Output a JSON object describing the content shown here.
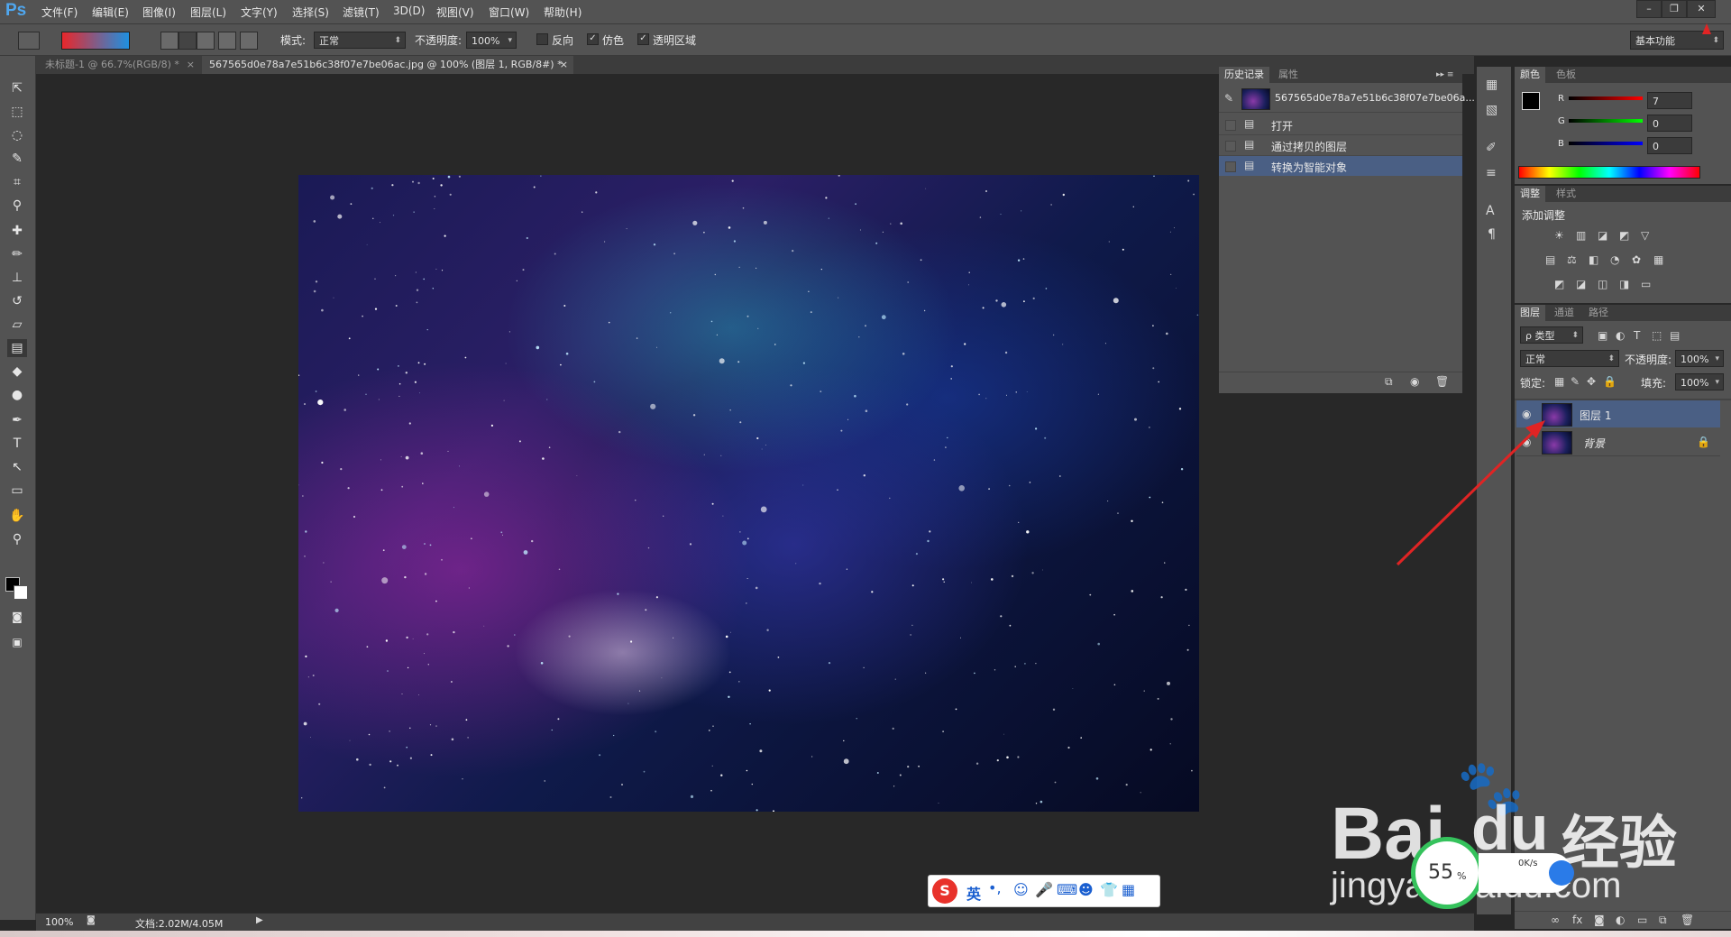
{
  "app": {
    "logo": "Ps"
  },
  "menubar": {
    "items": [
      "文件(F)",
      "编辑(E)",
      "图像(I)",
      "图层(L)",
      "文字(Y)",
      "选择(S)",
      "滤镜(T)",
      "3D(D)",
      "视图(V)",
      "窗口(W)",
      "帮助(H)"
    ],
    "window_controls": {
      "minimize": "–",
      "restore": "❐",
      "close": "✕"
    }
  },
  "options": {
    "mode_label": "模式:",
    "mode_value": "正常",
    "opacity_label": "不透明度:",
    "opacity_value": "100%",
    "reverse_label": "反向",
    "dither_label": "仿色",
    "transparency_label": "透明区域",
    "workspace_value": "基本功能",
    "gradient_colors": [
      "#e8272b",
      "#1e90e0"
    ]
  },
  "tabs": [
    {
      "label": "未标题-1 @ 66.7%(RGB/8) *",
      "close": "×"
    },
    {
      "label": "567565d0e78a7e51b6c38f07e7be06ac.jpg @ 100% (图层 1, RGB/8#) *",
      "close": "×"
    }
  ],
  "history": {
    "tabs": [
      "历史记录",
      "属性"
    ],
    "snapshot_name": "567565d0e78a7e51b6c38f07e7be06a...",
    "items": [
      "打开",
      "通过拷贝的图层",
      "转换为智能对象"
    ]
  },
  "color_panel": {
    "tabs": [
      "颜色",
      "色板"
    ],
    "channels": [
      {
        "label": "R",
        "value": "7"
      },
      {
        "label": "G",
        "value": "0"
      },
      {
        "label": "B",
        "value": "0"
      }
    ]
  },
  "adjustments": {
    "tabs": [
      "调整",
      "样式"
    ],
    "add_label": "添加调整",
    "row1": [
      "☀",
      "▥",
      "◪",
      "◩",
      "▽"
    ],
    "row2": [
      "▤",
      "⚖",
      "◧",
      "◔",
      "✿",
      "▦"
    ],
    "row3": [
      "◩",
      "◪",
      "◫",
      "◨",
      "▭"
    ]
  },
  "layers": {
    "tabs": [
      "图层",
      "通道",
      "路径"
    ],
    "filter_label": "ρ 类型",
    "blend_value": "正常",
    "opacity_label": "不透明度:",
    "opacity_value": "100%",
    "lock_label": "锁定:",
    "fill_label": "填充:",
    "fill_value": "100%",
    "items": [
      {
        "name": "图层 1",
        "selected": true
      },
      {
        "name": "背景",
        "selected": false
      }
    ]
  },
  "status": {
    "zoom": "100%",
    "doc_info": "文档:2.02M/4.05M"
  },
  "ime": {
    "lang": "英",
    "punct": "•,"
  },
  "overlay": {
    "percent": "55",
    "percent_sign": "%",
    "net_speed": "0K/s",
    "watermark_brand": "Bai",
    "watermark_du": "du",
    "watermark_cn": "经验",
    "watermark_url": "jingyan.baidu.com"
  },
  "colors": {
    "panel_bg": "#535353",
    "workspace_bg": "#282828",
    "selection_blue": "#4a5f84",
    "annotation_red": "#e02424"
  }
}
